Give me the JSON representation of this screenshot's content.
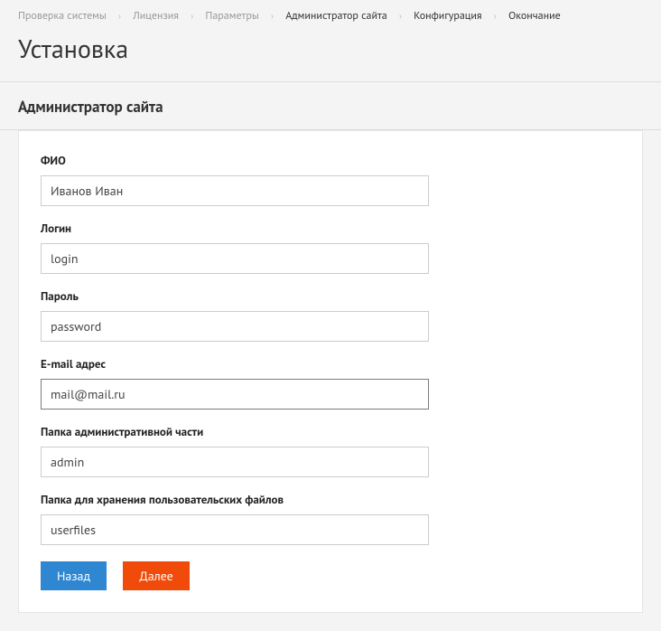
{
  "breadcrumb": {
    "items": [
      {
        "label": "Проверка системы",
        "active": false
      },
      {
        "label": "Лицензия",
        "active": false
      },
      {
        "label": "Параметры",
        "active": false
      },
      {
        "label": "Администратор сайта",
        "active": true
      },
      {
        "label": "Конфигурация",
        "active": true
      },
      {
        "label": "Окончание",
        "active": true
      }
    ]
  },
  "page_title": "Установка",
  "section_title": "Администратор сайта",
  "form": {
    "fio": {
      "label": "ФИО",
      "value": "Иванов Иван"
    },
    "login": {
      "label": "Логин",
      "value": "login"
    },
    "password": {
      "label": "Пароль",
      "value": "password"
    },
    "email": {
      "label": "E-mail адрес",
      "value": "mail@mail.ru"
    },
    "admin_folder": {
      "label": "Папка административной части",
      "value": "admin"
    },
    "user_folder": {
      "label": "Папка для хранения пользовательских файлов",
      "value": "userfiles"
    }
  },
  "buttons": {
    "back": "Назад",
    "next": "Далее"
  }
}
